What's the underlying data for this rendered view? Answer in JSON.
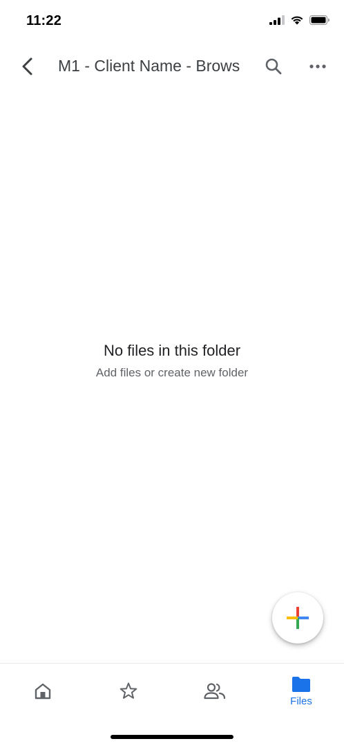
{
  "status_bar": {
    "time": "11:22"
  },
  "header": {
    "title": "M1 - Client Name - Brows"
  },
  "empty_state": {
    "title": "No files in this folder",
    "subtitle": "Add files or create new folder"
  },
  "bottom_nav": {
    "items": [
      {
        "icon": "home-icon",
        "label": ""
      },
      {
        "icon": "star-icon",
        "label": ""
      },
      {
        "icon": "shared-people-icon",
        "label": ""
      },
      {
        "icon": "folder-icon",
        "label": "Files",
        "active": true
      }
    ]
  },
  "colors": {
    "accent": "#1a73e8",
    "icon_gray": "#5f6368",
    "google_red": "#ea4335",
    "google_blue": "#4285f4",
    "google_yellow": "#fbbc04",
    "google_green": "#34a853"
  }
}
